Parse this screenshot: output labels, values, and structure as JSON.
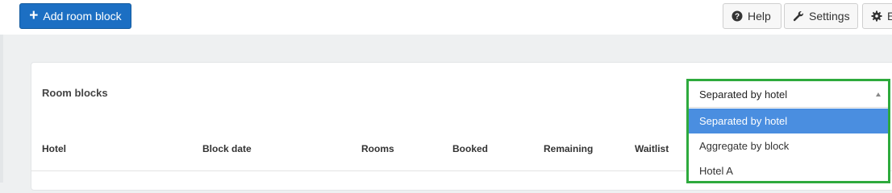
{
  "toolbar": {
    "add_label": "Add room block",
    "help_label": "Help",
    "settings_label": "Settings",
    "extra_label": "E"
  },
  "card": {
    "title": "Room blocks",
    "columns": [
      "Hotel",
      "Block date",
      "Rooms",
      "Booked",
      "Remaining",
      "Waitlist"
    ]
  },
  "grouping_select": {
    "value": "Separated by hotel",
    "options": [
      "Separated by hotel",
      "Aggregate by block",
      "Hotel A"
    ],
    "selected_index": 0
  },
  "colors": {
    "primary": "#1c6fc3",
    "highlight_border": "#2eaa3d",
    "option_selected": "#4a8ee0"
  }
}
